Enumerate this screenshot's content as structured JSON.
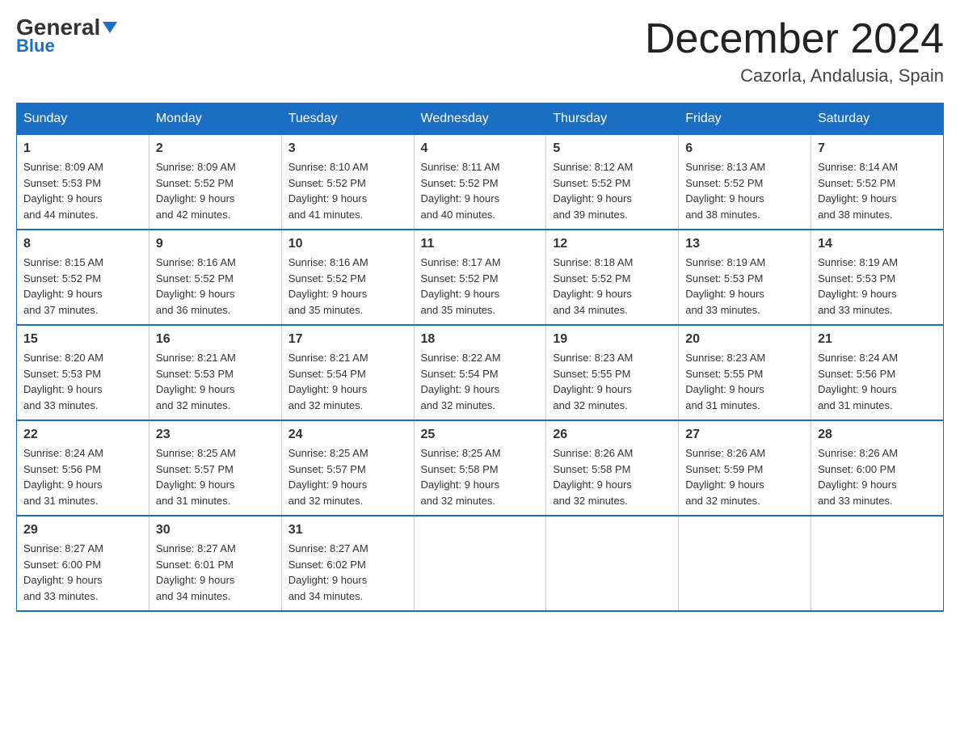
{
  "header": {
    "logo_general": "General",
    "logo_blue": "Blue",
    "month_title": "December 2024",
    "location": "Cazorla, Andalusia, Spain"
  },
  "days_of_week": [
    "Sunday",
    "Monday",
    "Tuesday",
    "Wednesday",
    "Thursday",
    "Friday",
    "Saturday"
  ],
  "weeks": [
    [
      {
        "day": "1",
        "sunrise": "8:09 AM",
        "sunset": "5:53 PM",
        "daylight": "9 hours and 44 minutes."
      },
      {
        "day": "2",
        "sunrise": "8:09 AM",
        "sunset": "5:52 PM",
        "daylight": "9 hours and 42 minutes."
      },
      {
        "day": "3",
        "sunrise": "8:10 AM",
        "sunset": "5:52 PM",
        "daylight": "9 hours and 41 minutes."
      },
      {
        "day": "4",
        "sunrise": "8:11 AM",
        "sunset": "5:52 PM",
        "daylight": "9 hours and 40 minutes."
      },
      {
        "day": "5",
        "sunrise": "8:12 AM",
        "sunset": "5:52 PM",
        "daylight": "9 hours and 39 minutes."
      },
      {
        "day": "6",
        "sunrise": "8:13 AM",
        "sunset": "5:52 PM",
        "daylight": "9 hours and 38 minutes."
      },
      {
        "day": "7",
        "sunrise": "8:14 AM",
        "sunset": "5:52 PM",
        "daylight": "9 hours and 38 minutes."
      }
    ],
    [
      {
        "day": "8",
        "sunrise": "8:15 AM",
        "sunset": "5:52 PM",
        "daylight": "9 hours and 37 minutes."
      },
      {
        "day": "9",
        "sunrise": "8:16 AM",
        "sunset": "5:52 PM",
        "daylight": "9 hours and 36 minutes."
      },
      {
        "day": "10",
        "sunrise": "8:16 AM",
        "sunset": "5:52 PM",
        "daylight": "9 hours and 35 minutes."
      },
      {
        "day": "11",
        "sunrise": "8:17 AM",
        "sunset": "5:52 PM",
        "daylight": "9 hours and 35 minutes."
      },
      {
        "day": "12",
        "sunrise": "8:18 AM",
        "sunset": "5:52 PM",
        "daylight": "9 hours and 34 minutes."
      },
      {
        "day": "13",
        "sunrise": "8:19 AM",
        "sunset": "5:53 PM",
        "daylight": "9 hours and 33 minutes."
      },
      {
        "day": "14",
        "sunrise": "8:19 AM",
        "sunset": "5:53 PM",
        "daylight": "9 hours and 33 minutes."
      }
    ],
    [
      {
        "day": "15",
        "sunrise": "8:20 AM",
        "sunset": "5:53 PM",
        "daylight": "9 hours and 33 minutes."
      },
      {
        "day": "16",
        "sunrise": "8:21 AM",
        "sunset": "5:53 PM",
        "daylight": "9 hours and 32 minutes."
      },
      {
        "day": "17",
        "sunrise": "8:21 AM",
        "sunset": "5:54 PM",
        "daylight": "9 hours and 32 minutes."
      },
      {
        "day": "18",
        "sunrise": "8:22 AM",
        "sunset": "5:54 PM",
        "daylight": "9 hours and 32 minutes."
      },
      {
        "day": "19",
        "sunrise": "8:23 AM",
        "sunset": "5:55 PM",
        "daylight": "9 hours and 32 minutes."
      },
      {
        "day": "20",
        "sunrise": "8:23 AM",
        "sunset": "5:55 PM",
        "daylight": "9 hours and 31 minutes."
      },
      {
        "day": "21",
        "sunrise": "8:24 AM",
        "sunset": "5:56 PM",
        "daylight": "9 hours and 31 minutes."
      }
    ],
    [
      {
        "day": "22",
        "sunrise": "8:24 AM",
        "sunset": "5:56 PM",
        "daylight": "9 hours and 31 minutes."
      },
      {
        "day": "23",
        "sunrise": "8:25 AM",
        "sunset": "5:57 PM",
        "daylight": "9 hours and 31 minutes."
      },
      {
        "day": "24",
        "sunrise": "8:25 AM",
        "sunset": "5:57 PM",
        "daylight": "9 hours and 32 minutes."
      },
      {
        "day": "25",
        "sunrise": "8:25 AM",
        "sunset": "5:58 PM",
        "daylight": "9 hours and 32 minutes."
      },
      {
        "day": "26",
        "sunrise": "8:26 AM",
        "sunset": "5:58 PM",
        "daylight": "9 hours and 32 minutes."
      },
      {
        "day": "27",
        "sunrise": "8:26 AM",
        "sunset": "5:59 PM",
        "daylight": "9 hours and 32 minutes."
      },
      {
        "day": "28",
        "sunrise": "8:26 AM",
        "sunset": "6:00 PM",
        "daylight": "9 hours and 33 minutes."
      }
    ],
    [
      {
        "day": "29",
        "sunrise": "8:27 AM",
        "sunset": "6:00 PM",
        "daylight": "9 hours and 33 minutes."
      },
      {
        "day": "30",
        "sunrise": "8:27 AM",
        "sunset": "6:01 PM",
        "daylight": "9 hours and 34 minutes."
      },
      {
        "day": "31",
        "sunrise": "8:27 AM",
        "sunset": "6:02 PM",
        "daylight": "9 hours and 34 minutes."
      },
      null,
      null,
      null,
      null
    ]
  ],
  "labels": {
    "sunrise": "Sunrise:",
    "sunset": "Sunset:",
    "daylight": "Daylight:"
  }
}
